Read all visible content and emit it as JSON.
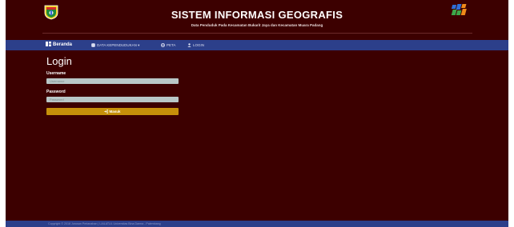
{
  "header": {
    "title": "SISTEM INFORMASI GEOGRAFIS",
    "subtitle": "Data Penduduk Pada Kecamatan Bukarit Jaya dan Kecamatan Muara Padang",
    "left_logo": "regency-crest-logo",
    "right_logo": "bps-logo"
  },
  "nav": {
    "items": [
      {
        "label": "Beranda",
        "icon": "dashboard-icon",
        "active": true
      },
      {
        "label": "DATA KEPENDUDUKAN ▾",
        "icon": "database-icon",
        "active": false
      },
      {
        "label": "PETA",
        "icon": "globe-icon",
        "active": false
      },
      {
        "label": "LOGIN",
        "icon": "user-icon",
        "active": false
      }
    ]
  },
  "login": {
    "title": "Login",
    "username_label": "Username",
    "username_placeholder": "Username",
    "password_label": "Password",
    "password_placeholder": "Password",
    "button_label": "Masuk",
    "button_icon": "sign-in-icon"
  },
  "footer": {
    "text": "Copyright © 2018 Jurusan Pertanahan | LAILATUL Universitas Bina Darma - Palembang"
  },
  "colors": {
    "background": "#3c0000",
    "navbar": "#2c3f8a",
    "button": "#c6900a",
    "input": "#b9c7c7"
  }
}
